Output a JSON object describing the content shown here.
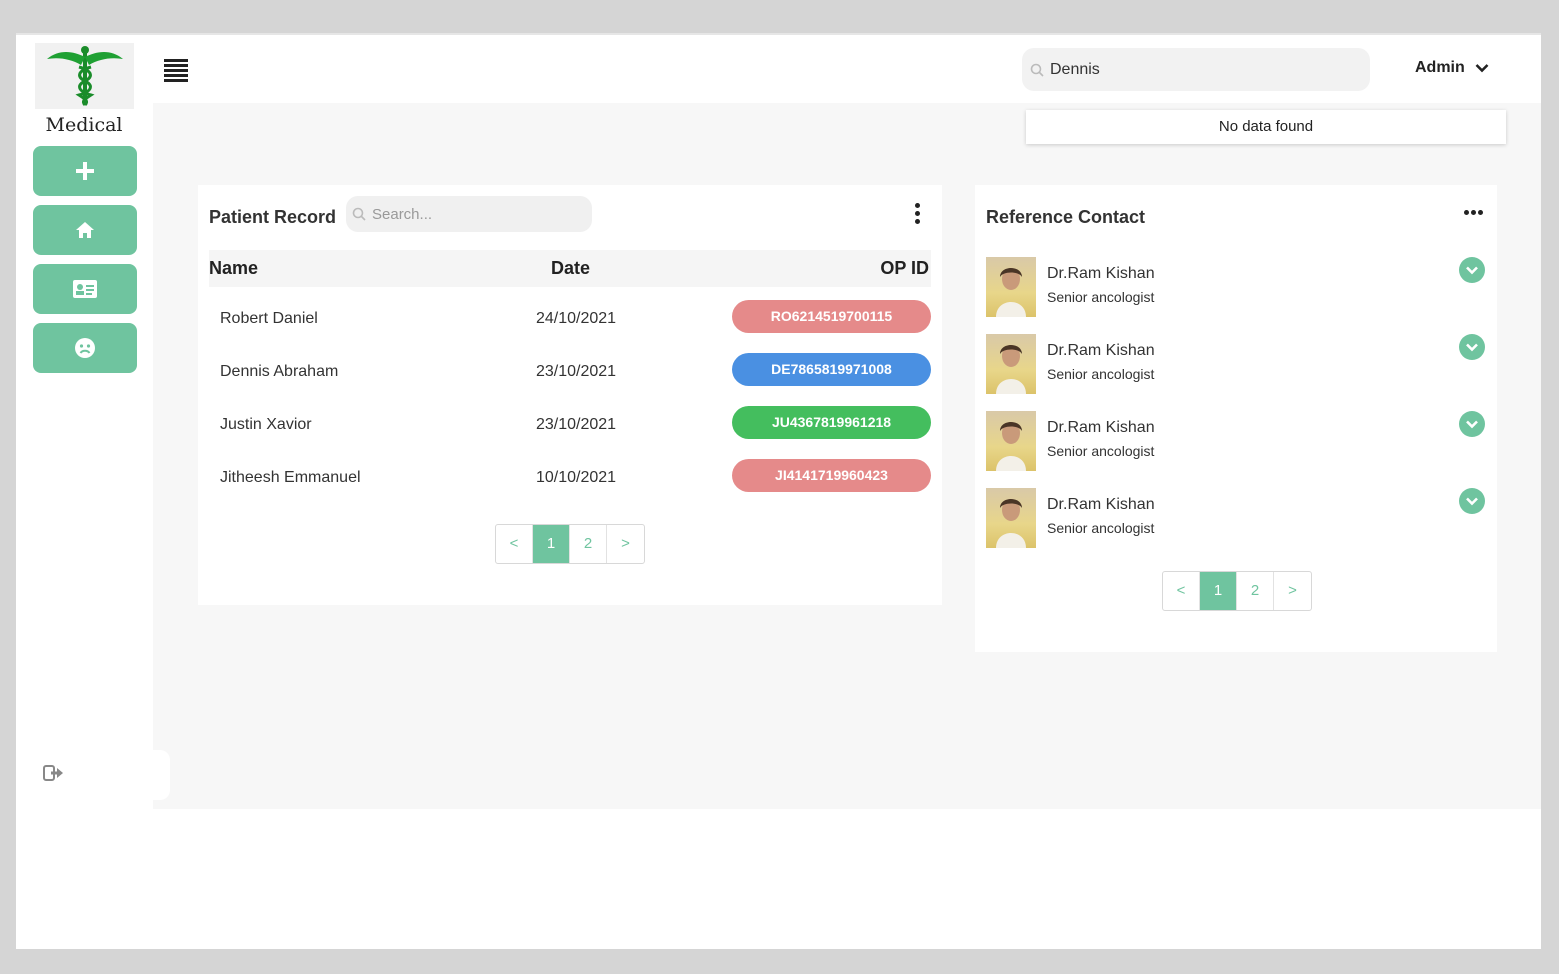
{
  "app": {
    "logo_text": "Medical"
  },
  "sidebar": {
    "items": [
      {
        "icon": "plus-icon"
      },
      {
        "icon": "home-icon"
      },
      {
        "icon": "id-card-icon"
      },
      {
        "icon": "sad-face-icon"
      }
    ],
    "logout_icon": "logout-icon",
    "accent": "#6fc49f"
  },
  "header": {
    "search_value": "Dennis",
    "user_label": "Admin",
    "search_result": "No data found"
  },
  "patient_record": {
    "title": "Patient Record",
    "search_placeholder": "Search...",
    "columns": [
      "Name",
      "Date",
      "OP ID"
    ],
    "rows": [
      {
        "name": "Robert Daniel",
        "date": "24/10/2021",
        "op_id": "RO6214519700115",
        "color": "#e58a8a"
      },
      {
        "name": "Dennis Abraham",
        "date": "23/10/2021",
        "op_id": "DE7865819971008",
        "color": "#4a90e2"
      },
      {
        "name": "Justin Xavior",
        "date": "23/10/2021",
        "op_id": "JU4367819961218",
        "color": "#44be5e"
      },
      {
        "name": "Jitheesh Emmanuel",
        "date": "10/10/2021",
        "op_id": "JI4141719960423",
        "color": "#e58a8a"
      }
    ],
    "pagination": {
      "prev": "<",
      "pages": [
        "1",
        "2"
      ],
      "active": "1",
      "next": ">"
    }
  },
  "reference_contact": {
    "title": "Reference Contact",
    "contacts": [
      {
        "name": "Dr.Ram Kishan",
        "role": "Senior ancologist"
      },
      {
        "name": "Dr.Ram Kishan",
        "role": "Senior ancologist"
      },
      {
        "name": "Dr.Ram Kishan",
        "role": "Senior ancologist"
      },
      {
        "name": "Dr.Ram Kishan",
        "role": "Senior ancologist"
      }
    ],
    "pagination": {
      "prev": "<",
      "pages": [
        "1",
        "2"
      ],
      "active": "1",
      "next": ">"
    }
  }
}
